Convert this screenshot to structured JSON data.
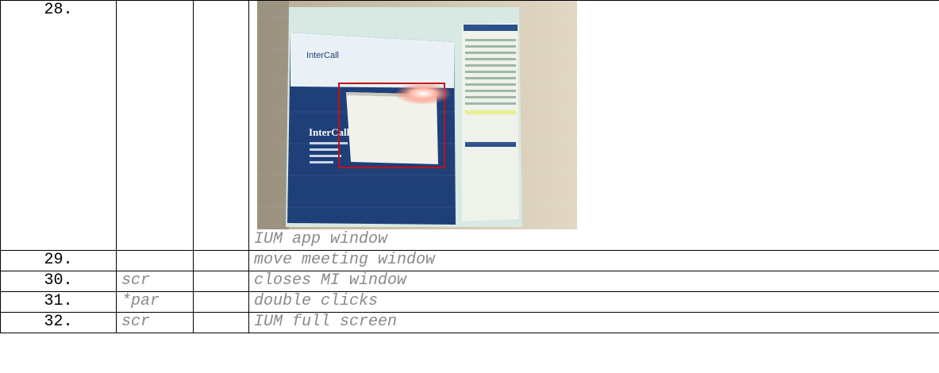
{
  "rows": [
    {
      "num": "28.",
      "code": "",
      "note": "IUM app window",
      "has_photo": true
    },
    {
      "num": "29.",
      "code": "",
      "note": "move meeting window"
    },
    {
      "num": "30.",
      "code": "scr",
      "note": "closes MI window"
    },
    {
      "num": "31.",
      "code": "*par",
      "note": "double clicks"
    },
    {
      "num": "32.",
      "code": "scr",
      "note": "IUM full screen"
    }
  ],
  "photo": {
    "brand_logo_text": "InterCall",
    "slide_title": "InterCall Uni",
    "colors": {
      "slide_bg": "#1f3f78",
      "highlight_box": "#c0101a",
      "monitor_bezel": "#d9cdb6"
    }
  }
}
